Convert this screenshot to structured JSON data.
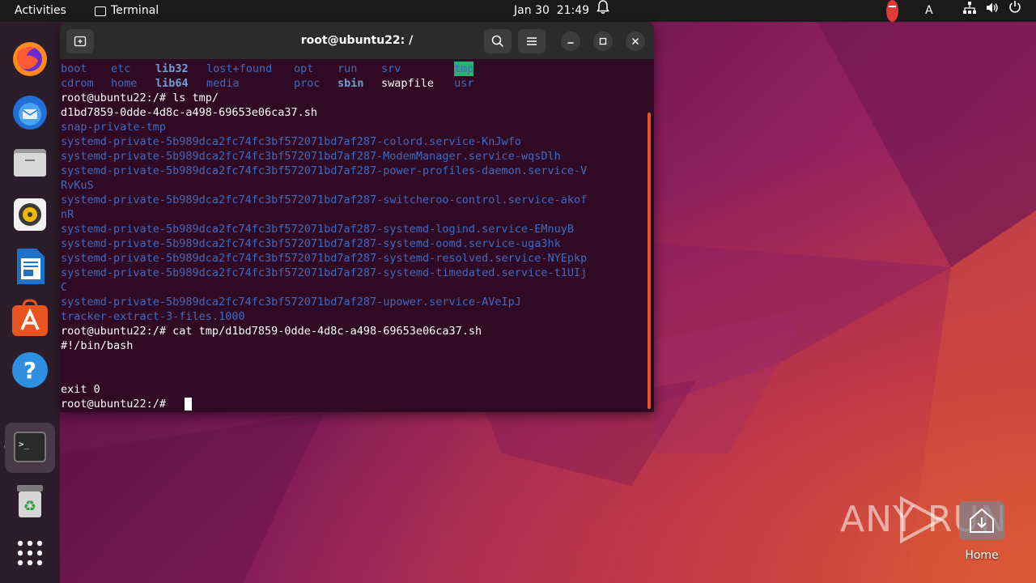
{
  "topbar": {
    "activities": "Activities",
    "app_name": "Terminal",
    "clock": "Jan 30  21:49",
    "keyboard_layout": "A"
  },
  "dock": {
    "items": [
      "firefox",
      "thunderbird",
      "files",
      "rhythmbox",
      "libreoffice-writer",
      "app-center",
      "help",
      "terminal",
      "trash",
      "show-apps"
    ]
  },
  "terminal": {
    "title": "root@ubuntu22: /",
    "ls_root_row1": [
      "boot",
      "etc",
      "lib32",
      "lost+found",
      "opt",
      "run",
      "srv",
      "tmp"
    ],
    "ls_root_row2": [
      "cdrom",
      "home",
      "lib64",
      "media",
      "proc",
      "sbin",
      "swapfile",
      "usr"
    ],
    "lines": {
      "l1": "root@ubuntu22:/# ls tmp/",
      "l2": "d1bd7859-0dde-4d8c-a498-69653e06ca37.sh",
      "l3": "snap-private-tmp",
      "l4": "systemd-private-5b989dca2fc74fc3bf572071bd7af287-colord.service-KnJwfo",
      "l5": "systemd-private-5b989dca2fc74fc3bf572071bd7af287-ModemManager.service-wqsDlh",
      "l6": "systemd-private-5b989dca2fc74fc3bf572071bd7af287-power-profiles-daemon.service-V",
      "l7": "RvKuS",
      "l8": "systemd-private-5b989dca2fc74fc3bf572071bd7af287-switcheroo-control.service-akof",
      "l9": "nR",
      "l10": "systemd-private-5b989dca2fc74fc3bf572071bd7af287-systemd-logind.service-EMnuyB",
      "l11": "systemd-private-5b989dca2fc74fc3bf572071bd7af287-systemd-oomd.service-uga3hk",
      "l12": "systemd-private-5b989dca2fc74fc3bf572071bd7af287-systemd-resolved.service-NYEpkp",
      "l13": "systemd-private-5b989dca2fc74fc3bf572071bd7af287-systemd-timedated.service-t1UIj",
      "l14": "C",
      "l15": "systemd-private-5b989dca2fc74fc3bf572071bd7af287-upower.service-AVeIpJ",
      "l16": "tracker-extract-3-files.1000",
      "l17": "root@ubuntu22:/# cat tmp/d1bd7859-0dde-4d8c-a498-69653e06ca37.sh",
      "l18": "#!/bin/bash",
      "l19": "",
      "l20": "",
      "l21": "exit 0",
      "l22": "root@ubuntu22:/# "
    }
  },
  "desktop": {
    "watermark": "ANY RUN",
    "home_label": "Home"
  },
  "colors": {
    "terminal_bg": "#300a24",
    "dir_blue": "#3f6bbf",
    "accent": "#e95420"
  }
}
